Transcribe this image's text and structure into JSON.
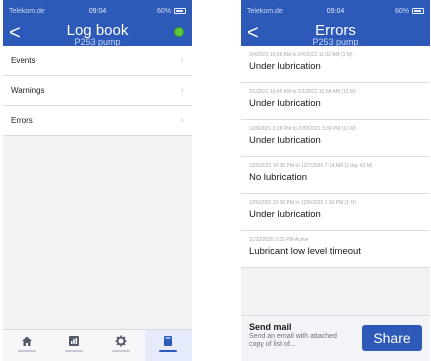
{
  "left_screen": {
    "status": {
      "carrier": "Telekom.de",
      "time": "09:04",
      "battery": "60%"
    },
    "nav": {
      "back": "<",
      "title": "Log book",
      "subtitle": "P253 pump"
    },
    "menu": [
      {
        "label": "Events"
      },
      {
        "label": "Warnings"
      },
      {
        "label": "Errors"
      }
    ],
    "tabs": [
      {
        "icon": "home-icon"
      },
      {
        "icon": "dashboard-icon"
      },
      {
        "icon": "gear-icon"
      },
      {
        "icon": "book-icon",
        "active": true
      }
    ]
  },
  "right_screen": {
    "status": {
      "carrier": "Telekom.de",
      "time": "09:04",
      "battery": "60%"
    },
    "nav": {
      "back": "<",
      "title": "Errors",
      "subtitle": "P253 pump"
    },
    "errors": [
      {
        "meta": "2/4/2021 10:56 AM to 2/4/2021 11:02 AM (3 M)",
        "title": "Under lubrication"
      },
      {
        "meta": "2/1/2021 10:45 AM to 2/1/2021 10:58 AM (13 M)",
        "title": "Under lubrication"
      },
      {
        "meta": "12/9/2021 3:28 PM to 12/9/2021 3:39 PM (11 M)",
        "title": "Under lubrication"
      },
      {
        "meta": "12/6/2020 10:35 PM to 12/7/2020 7:14 AM (1 day 43 M)",
        "title": "No lubrication"
      },
      {
        "meta": "12/6/2020 12:36 PM to 12/6/2020 1:36 PM (1 H)",
        "title": "Under lubrication"
      },
      {
        "meta": "11/23/2020 2:32 PM Active",
        "title": "Lubricant low level timeout"
      }
    ],
    "mail": {
      "title": "Send mail",
      "description": "Send an email with attached copy of list of...",
      "share": "Share"
    }
  },
  "colors": {
    "primary": "#2d5ab8",
    "status_dot": "#5ac83a"
  }
}
